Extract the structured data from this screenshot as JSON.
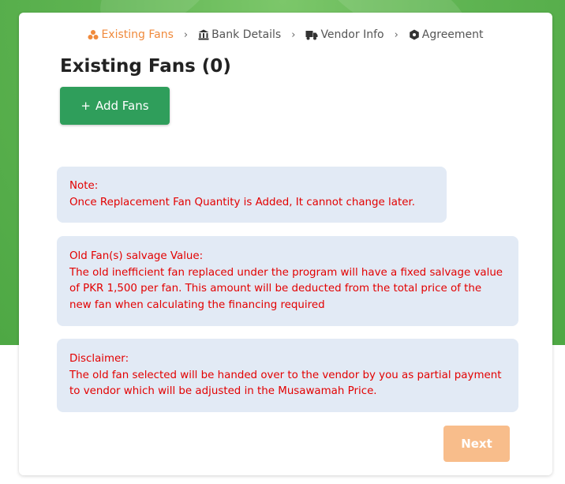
{
  "colors": {
    "background_green": "#5fb452",
    "active_step": "#f08a3c",
    "add_button": "#2f9e5b",
    "note_text": "#e30000",
    "note_bg": "#e2eaf5",
    "next_button_disabled": "#f8bd8b"
  },
  "stepper": {
    "steps": [
      {
        "label": "Existing Fans",
        "icon": "fans-icon",
        "active": true
      },
      {
        "label": "Bank Details",
        "icon": "bank-icon",
        "active": false
      },
      {
        "label": "Vendor Info",
        "icon": "truck-icon",
        "active": false
      },
      {
        "label": "Agreement",
        "icon": "hexagon-icon",
        "active": false
      }
    ],
    "separator": "›"
  },
  "main": {
    "title": "Existing Fans (0)",
    "add_button_icon": "+",
    "add_button_label": "Add Fans"
  },
  "notes": {
    "note": {
      "heading": "Note:",
      "body": "Once Replacement Fan Quantity is Added, It cannot change later."
    },
    "salvage": {
      "heading": "Old Fan(s) salvage Value:",
      "body": "The old inefficient fan replaced under the program will have a fixed salvage value of PKR 1,500 per fan. This amount will be deducted from the total price of the new fan when calculating the financing required"
    },
    "disclaimer": {
      "heading": "Disclaimer:",
      "body": "The old fan selected will be handed over to the vendor by you as partial payment to vendor which will be adjusted in the Musawamah Price."
    }
  },
  "footer": {
    "next_label": "Next"
  }
}
